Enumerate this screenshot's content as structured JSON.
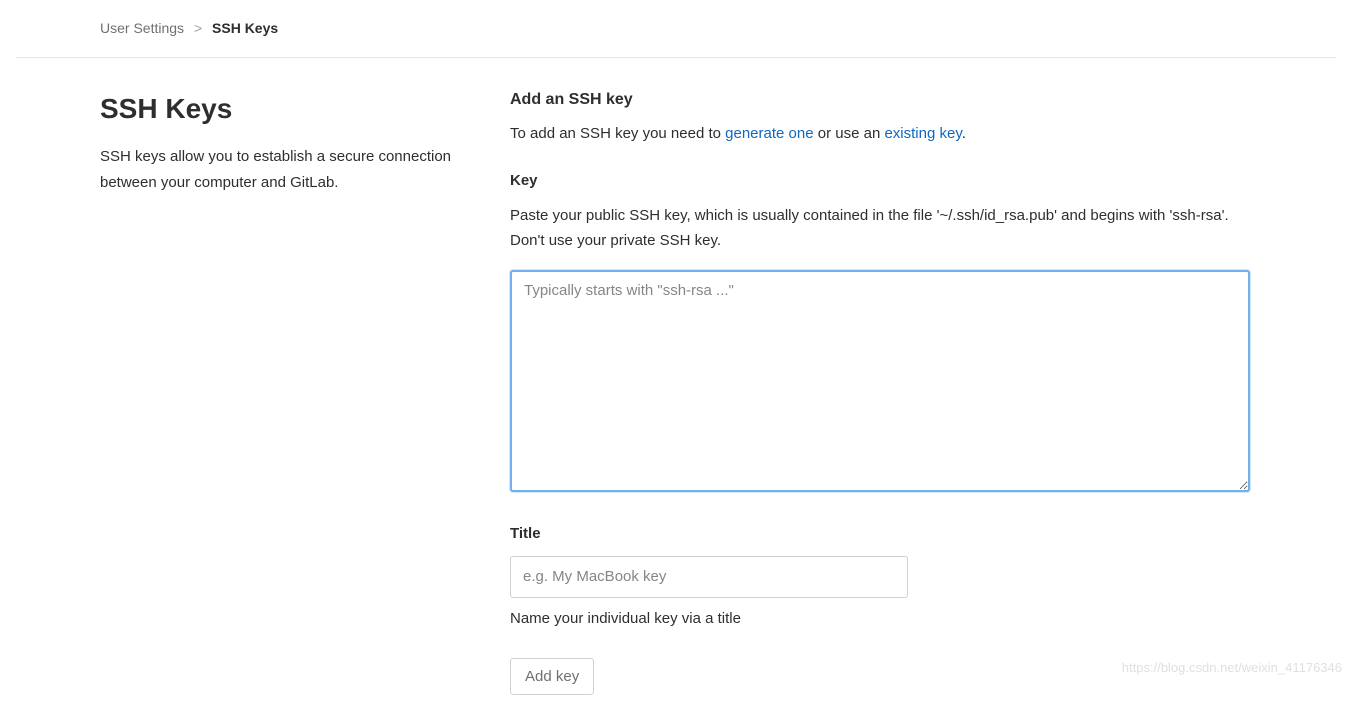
{
  "breadcrumb": {
    "parent": "User Settings",
    "separator": ">",
    "current": "SSH Keys"
  },
  "left": {
    "title": "SSH Keys",
    "description": "SSH keys allow you to establish a secure connection between your computer and GitLab."
  },
  "form": {
    "heading": "Add an SSH key",
    "intro_prefix": "To add an SSH key you need to ",
    "intro_link1": "generate one",
    "intro_mid": " or use an ",
    "intro_link2": "existing key",
    "intro_suffix": ".",
    "key_label": "Key",
    "key_description": "Paste your public SSH key, which is usually contained in the file '~/.ssh/id_rsa.pub' and begins with 'ssh-rsa'. Don't use your private SSH key.",
    "key_placeholder": "Typically starts with \"ssh-rsa ...\"",
    "title_label": "Title",
    "title_placeholder": "e.g. My MacBook key",
    "title_hint": "Name your individual key via a title",
    "submit_label": "Add key"
  },
  "watermark": "https://blog.csdn.net/weixin_41176346"
}
